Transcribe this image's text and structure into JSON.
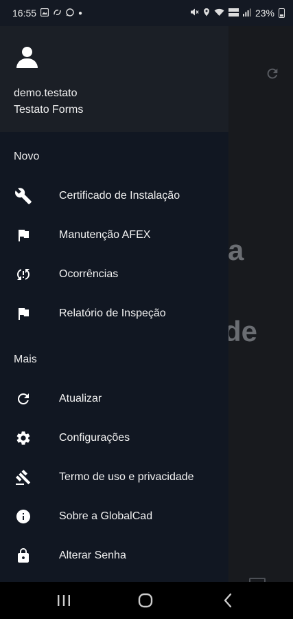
{
  "status_bar": {
    "time": "16:55",
    "battery": "23%",
    "notification_icons": [
      "image-icon",
      "sync-icon",
      "whatsapp-icon"
    ],
    "system_icons": [
      "mute-icon",
      "location-icon",
      "wifi-icon",
      "lte-icon",
      "signal-icon",
      "battery-icon"
    ]
  },
  "background": {
    "partial_text_1": "a",
    "partial_text_2": "de"
  },
  "drawer": {
    "user": {
      "username": "demo.testato",
      "app_name": "Testato Forms"
    },
    "sections": [
      {
        "title": "Novo",
        "items": [
          {
            "label": "Certificado de Instalação",
            "icon": "wrench-icon"
          },
          {
            "label": "Manutenção AFEX",
            "icon": "flag-icon"
          },
          {
            "label": "Ocorrências",
            "icon": "sync-alert-icon"
          },
          {
            "label": "Relatório de Inspeção",
            "icon": "flag-icon"
          }
        ]
      },
      {
        "title": "Mais",
        "items": [
          {
            "label": "Atualizar",
            "icon": "refresh-icon"
          },
          {
            "label": "Configurações",
            "icon": "gear-icon"
          },
          {
            "label": "Termo de uso e privacidade",
            "icon": "gavel-icon"
          },
          {
            "label": "Sobre a GlobalCad",
            "icon": "info-icon"
          },
          {
            "label": "Alterar Senha",
            "icon": "lock-icon"
          }
        ]
      }
    ]
  },
  "colors": {
    "drawer_bg": "#111722",
    "header_bg": "#1b1f26",
    "text": "#f2f2f2"
  }
}
